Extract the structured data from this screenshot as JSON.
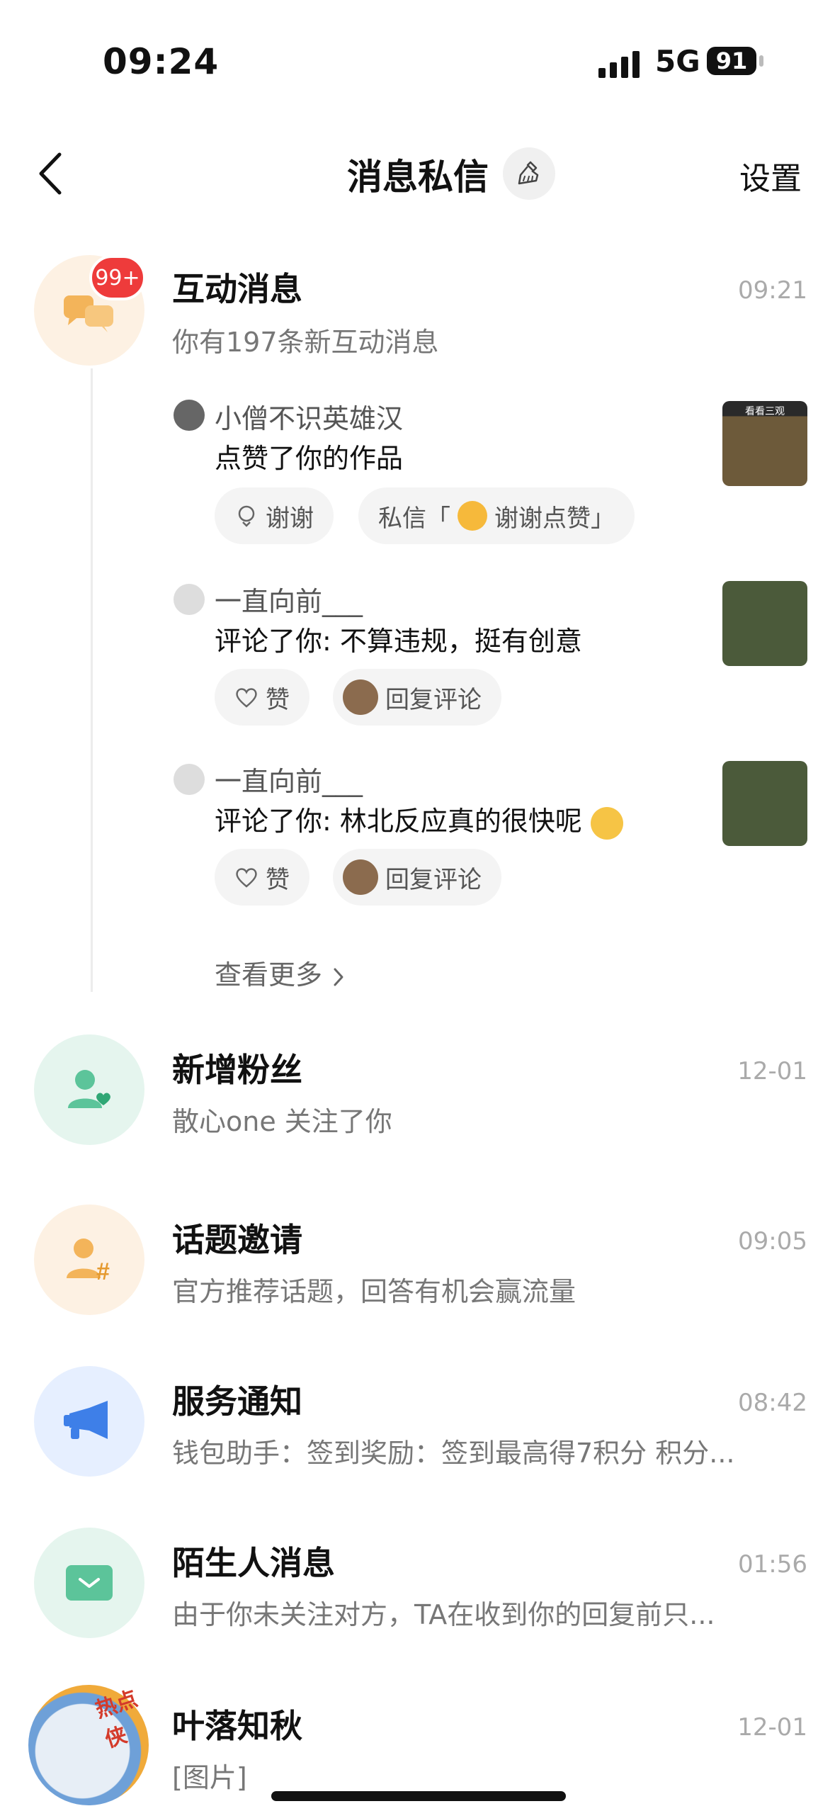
{
  "status_bar": {
    "time": "09:24",
    "network": "5G",
    "battery": "91"
  },
  "header": {
    "title": "消息私信",
    "settings_label": "设置"
  },
  "interactions": {
    "title": "互动消息",
    "badge": "99+",
    "subtitle": "你有197条新互动消息",
    "time": "09:21",
    "entries": [
      {
        "user": "小僧不识英雄汉",
        "action": "点赞了你的作品",
        "btn1": "谢谢",
        "btn2_prefix": "私信「",
        "btn2_text": "谢谢点赞」",
        "thumb_text": "看看三观"
      },
      {
        "user": "一直向前___",
        "action": "评论了你: 不算违规，挺有创意",
        "btn1": "赞",
        "btn2_text": "回复评论"
      },
      {
        "user": "一直向前___",
        "action": "评论了你: 林北反应真的很快呢",
        "btn1": "赞",
        "btn2_text": "回复评论"
      }
    ],
    "more": "查看更多"
  },
  "list": [
    {
      "title": "新增粉丝",
      "subtitle": "散心one 关注了你",
      "time": "12-01"
    },
    {
      "title": "话题邀请",
      "subtitle": "官方推荐话题，回答有机会赢流量",
      "time": "09:05"
    },
    {
      "title": "服务通知",
      "subtitle": "钱包助手：签到奖励：签到最高得7积分 积分...",
      "time": "08:42"
    },
    {
      "title": "陌生人消息",
      "subtitle": "由于你未关注对方，TA在收到你的回复前只...",
      "time": "01:56"
    },
    {
      "title": "叶落知秋",
      "subtitle": "[图片]",
      "time": "12-01",
      "avatar_text": "热点侠"
    }
  ],
  "colors": {
    "badge": "#ee3b3b",
    "interact_bg": "#fdf1e3",
    "fans_bg": "#e5f5ee",
    "topic_bg": "#fdf1e3",
    "service_bg": "#e6efff",
    "stranger_bg": "#e5f5ee"
  }
}
